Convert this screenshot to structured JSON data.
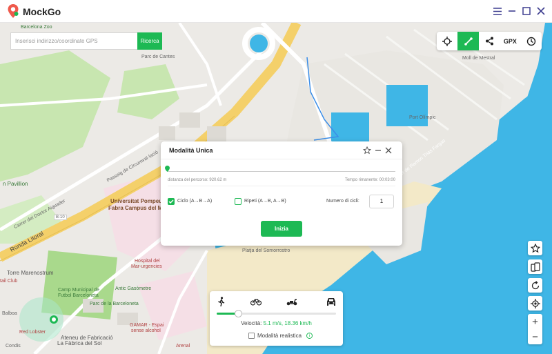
{
  "app": {
    "title": "MockGo"
  },
  "search": {
    "placeholder": "Inserisci indirizzo/coordinate GPS",
    "button_label": "Ricerca"
  },
  "toolbar": {
    "gpx_label": "GPX"
  },
  "modal": {
    "title": "Modalità Unica",
    "distance_label": "distanza del percorso: 920.62 m",
    "time_label": "Tempo rimanente: 00:03:00",
    "option_cycle": "Ciclo (A→B→A)",
    "option_repeat": "Ripeti (A→B, A→B)",
    "cycles_label": "Numero di cicli:",
    "cycles_value": "1",
    "start_button": "Inizia",
    "cycle_checked": true,
    "repeat_checked": false
  },
  "speed": {
    "label": "Velocità:",
    "value": "5.1 m/s, 18.36 km/h",
    "realistic_label": "Modalità realistica",
    "info_glyph": "i",
    "slider_fraction": 0.18
  },
  "zoom": {
    "in": "+",
    "out": "−"
  },
  "map": {
    "labels": {
      "pavilion": "n Pavillion",
      "auto_parc": "Parc de Cantes",
      "universitat": "Universitat Pompeu",
      "universitat2": "Fabra Campus del Mar",
      "ronda": "Ronda Litoral",
      "carrer_doctor": "Carrer del Doctor Aiguader",
      "b10": "B-10",
      "torre": "Torre Marenostrum",
      "camp": "Camp Municipal de",
      "camp2": "Futbol Barceloneta",
      "antic": "Antic Gasòmetre",
      "parc_barceloneta": "Parc de la Barceloneta",
      "hospital": "Hospital del",
      "hospital2": "Mar-urgencies",
      "gamar": "GAMAR - Espai",
      "gamar2": "sense alcohol",
      "ateneu": "Ateneu de Fabricació",
      "ateneu2": "La Fàbrica del Sol",
      "platja": "Platja del Somorrostro",
      "arenal": "Arenal",
      "red_lobster": "Red Lobster",
      "condis": "Condis",
      "bballoa": "Balboa",
      "tail_club": "tail Club",
      "port_olimpic": "Port Olímpic",
      "moll": "Moll de Mestral",
      "barcelona_zoo": "Barcelona Zoo",
      "passeig": "Passeig de Circumval·lació",
      "carrer_ramon": "Carrer de Ramon Trias Fargas"
    }
  },
  "colors": {
    "accent": "#1db954",
    "sea": "#3fb6e6",
    "park": "#c8e6b0",
    "road_major": "#f4d06a"
  }
}
